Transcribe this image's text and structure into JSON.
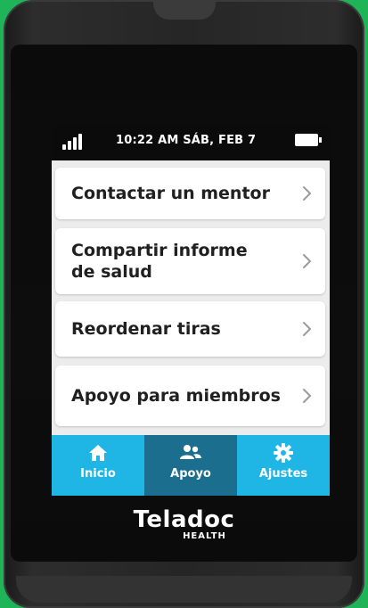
{
  "status_bar": {
    "datetime": "10:22 AM   SÁB, FEB 7"
  },
  "menu": {
    "items": [
      {
        "label": "Contactar un mentor"
      },
      {
        "label": "Compartir informe de salud"
      },
      {
        "label": "Reordenar tiras"
      },
      {
        "label": "Apoyo para miembros"
      }
    ]
  },
  "nav": {
    "items": [
      {
        "label": "Inicio",
        "icon": "home-icon"
      },
      {
        "label": "Apoyo",
        "icon": "people-icon",
        "active": true
      },
      {
        "label": "Ajustes",
        "icon": "gear-icon"
      }
    ]
  },
  "brand": {
    "name": "Teladoc",
    "sub": "HEALTH"
  },
  "colors": {
    "background": "#1fb457",
    "nav_inactive": "#1fb6e6",
    "nav_active": "#1c6e8e",
    "card": "#ffffff",
    "text": "#202020"
  }
}
